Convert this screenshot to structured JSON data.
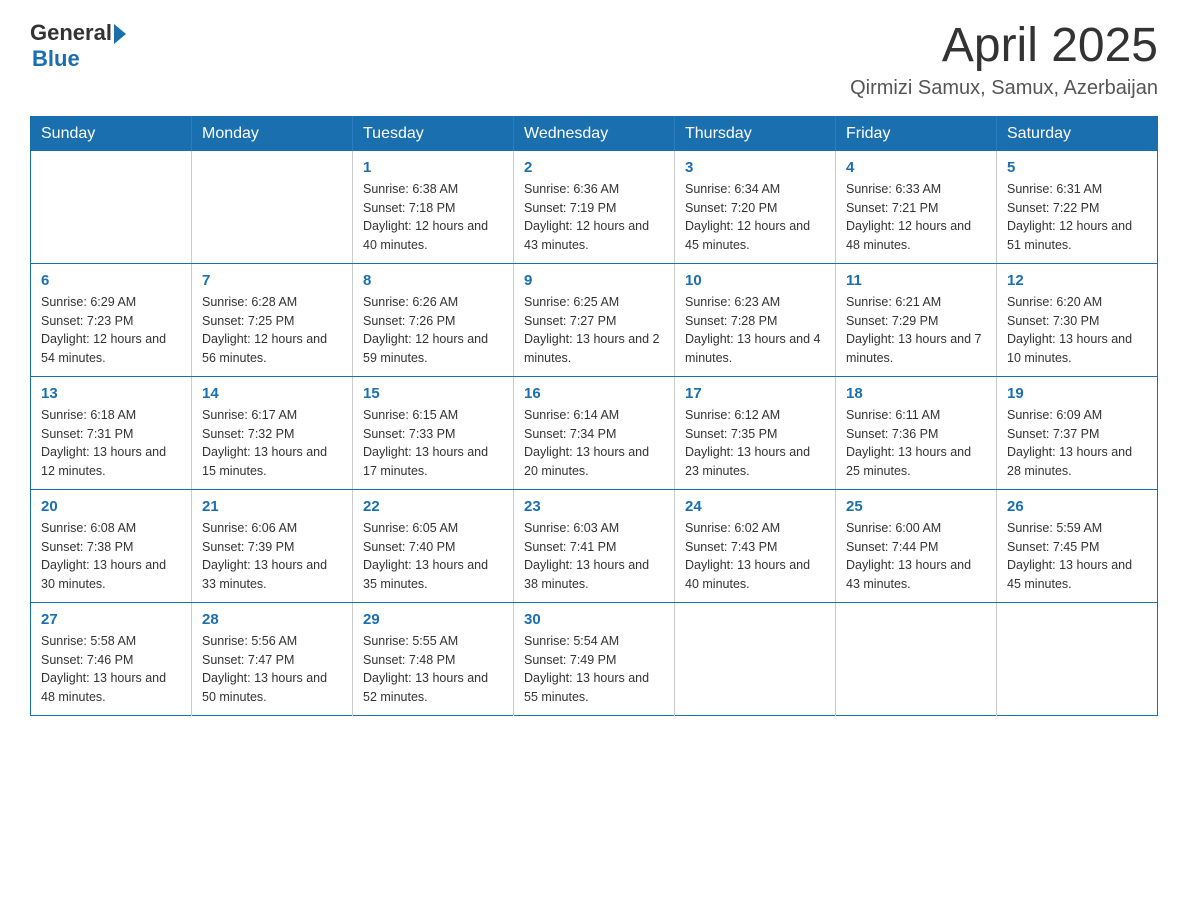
{
  "header": {
    "logo_general": "General",
    "logo_blue": "Blue",
    "title": "April 2025",
    "subtitle": "Qirmizi Samux, Samux, Azerbaijan"
  },
  "calendar": {
    "days_of_week": [
      "Sunday",
      "Monday",
      "Tuesday",
      "Wednesday",
      "Thursday",
      "Friday",
      "Saturday"
    ],
    "weeks": [
      [
        {
          "day": "",
          "info": ""
        },
        {
          "day": "",
          "info": ""
        },
        {
          "day": "1",
          "info": "Sunrise: 6:38 AM\nSunset: 7:18 PM\nDaylight: 12 hours\nand 40 minutes."
        },
        {
          "day": "2",
          "info": "Sunrise: 6:36 AM\nSunset: 7:19 PM\nDaylight: 12 hours\nand 43 minutes."
        },
        {
          "day": "3",
          "info": "Sunrise: 6:34 AM\nSunset: 7:20 PM\nDaylight: 12 hours\nand 45 minutes."
        },
        {
          "day": "4",
          "info": "Sunrise: 6:33 AM\nSunset: 7:21 PM\nDaylight: 12 hours\nand 48 minutes."
        },
        {
          "day": "5",
          "info": "Sunrise: 6:31 AM\nSunset: 7:22 PM\nDaylight: 12 hours\nand 51 minutes."
        }
      ],
      [
        {
          "day": "6",
          "info": "Sunrise: 6:29 AM\nSunset: 7:23 PM\nDaylight: 12 hours\nand 54 minutes."
        },
        {
          "day": "7",
          "info": "Sunrise: 6:28 AM\nSunset: 7:25 PM\nDaylight: 12 hours\nand 56 minutes."
        },
        {
          "day": "8",
          "info": "Sunrise: 6:26 AM\nSunset: 7:26 PM\nDaylight: 12 hours\nand 59 minutes."
        },
        {
          "day": "9",
          "info": "Sunrise: 6:25 AM\nSunset: 7:27 PM\nDaylight: 13 hours\nand 2 minutes."
        },
        {
          "day": "10",
          "info": "Sunrise: 6:23 AM\nSunset: 7:28 PM\nDaylight: 13 hours\nand 4 minutes."
        },
        {
          "day": "11",
          "info": "Sunrise: 6:21 AM\nSunset: 7:29 PM\nDaylight: 13 hours\nand 7 minutes."
        },
        {
          "day": "12",
          "info": "Sunrise: 6:20 AM\nSunset: 7:30 PM\nDaylight: 13 hours\nand 10 minutes."
        }
      ],
      [
        {
          "day": "13",
          "info": "Sunrise: 6:18 AM\nSunset: 7:31 PM\nDaylight: 13 hours\nand 12 minutes."
        },
        {
          "day": "14",
          "info": "Sunrise: 6:17 AM\nSunset: 7:32 PM\nDaylight: 13 hours\nand 15 minutes."
        },
        {
          "day": "15",
          "info": "Sunrise: 6:15 AM\nSunset: 7:33 PM\nDaylight: 13 hours\nand 17 minutes."
        },
        {
          "day": "16",
          "info": "Sunrise: 6:14 AM\nSunset: 7:34 PM\nDaylight: 13 hours\nand 20 minutes."
        },
        {
          "day": "17",
          "info": "Sunrise: 6:12 AM\nSunset: 7:35 PM\nDaylight: 13 hours\nand 23 minutes."
        },
        {
          "day": "18",
          "info": "Sunrise: 6:11 AM\nSunset: 7:36 PM\nDaylight: 13 hours\nand 25 minutes."
        },
        {
          "day": "19",
          "info": "Sunrise: 6:09 AM\nSunset: 7:37 PM\nDaylight: 13 hours\nand 28 minutes."
        }
      ],
      [
        {
          "day": "20",
          "info": "Sunrise: 6:08 AM\nSunset: 7:38 PM\nDaylight: 13 hours\nand 30 minutes."
        },
        {
          "day": "21",
          "info": "Sunrise: 6:06 AM\nSunset: 7:39 PM\nDaylight: 13 hours\nand 33 minutes."
        },
        {
          "day": "22",
          "info": "Sunrise: 6:05 AM\nSunset: 7:40 PM\nDaylight: 13 hours\nand 35 minutes."
        },
        {
          "day": "23",
          "info": "Sunrise: 6:03 AM\nSunset: 7:41 PM\nDaylight: 13 hours\nand 38 minutes."
        },
        {
          "day": "24",
          "info": "Sunrise: 6:02 AM\nSunset: 7:43 PM\nDaylight: 13 hours\nand 40 minutes."
        },
        {
          "day": "25",
          "info": "Sunrise: 6:00 AM\nSunset: 7:44 PM\nDaylight: 13 hours\nand 43 minutes."
        },
        {
          "day": "26",
          "info": "Sunrise: 5:59 AM\nSunset: 7:45 PM\nDaylight: 13 hours\nand 45 minutes."
        }
      ],
      [
        {
          "day": "27",
          "info": "Sunrise: 5:58 AM\nSunset: 7:46 PM\nDaylight: 13 hours\nand 48 minutes."
        },
        {
          "day": "28",
          "info": "Sunrise: 5:56 AM\nSunset: 7:47 PM\nDaylight: 13 hours\nand 50 minutes."
        },
        {
          "day": "29",
          "info": "Sunrise: 5:55 AM\nSunset: 7:48 PM\nDaylight: 13 hours\nand 52 minutes."
        },
        {
          "day": "30",
          "info": "Sunrise: 5:54 AM\nSunset: 7:49 PM\nDaylight: 13 hours\nand 55 minutes."
        },
        {
          "day": "",
          "info": ""
        },
        {
          "day": "",
          "info": ""
        },
        {
          "day": "",
          "info": ""
        }
      ]
    ]
  }
}
